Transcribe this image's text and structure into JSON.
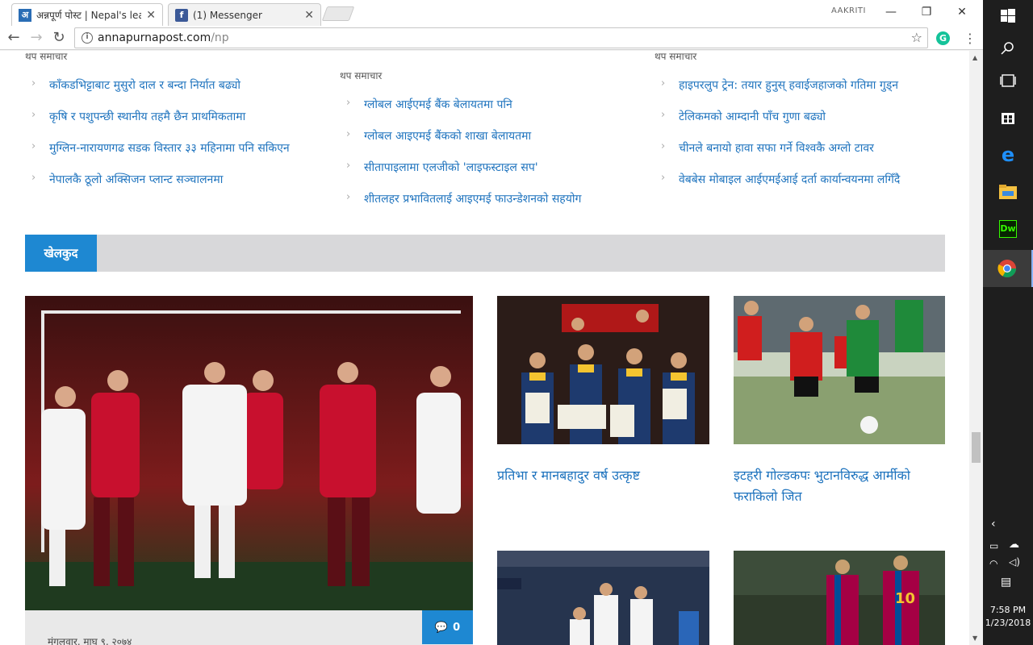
{
  "browser": {
    "tabs": [
      {
        "title": "अन्नपूर्ण पोस्ट | Nepal's lea",
        "favicon": "अ",
        "favicon_color": "#2a6db5"
      },
      {
        "title": "(1) Messenger",
        "favicon": "f",
        "favicon_color": "#3b5998"
      }
    ],
    "user": "AAKRITI",
    "url_domain": "annapurnapost.com",
    "url_path": "/np"
  },
  "news_columns": {
    "label": "थप समाचार",
    "left": [
      "काँकडभिट्टाबाट मुसुरो दाल र बन्दा निर्यात बढ्यो",
      "कृषि र पशुपन्छी  स्थानीय तहमै छैन प्राथमिकतामा",
      "मुग्लिन-नारायणगढ सडक विस्तार ३३ महिनामा पनि सकिएन",
      "नेपालकै ठूलो अक्सिजन प्लान्ट सञ्चालनमा"
    ],
    "middle": [
      "ग्लोबल आईएमई बैंक बेलायतमा पनि",
      "ग्लोबल आइएमई बैंकको शाखा बेलायतमा",
      "सीतापाइलामा एलजीको 'लाइफस्टाइल सप'",
      "शीतलहर प्रभावितलाई आइएमई फाउन्डेशनको सहयोग"
    ],
    "right": [
      "हाइपरलुप ट्रेन: तयार हुनुस् हवाईजहाजको गतिमा गुड्न",
      "टेलिकमको आम्दानी पाँच गुणा बढ्यो",
      "चीनले बनायो हावा सफा गर्ने विश्वकै अग्लो टावर",
      "वेबबेस मोबाइल आईएमईआई दर्ता कार्यान्वयनमा लगिँदै"
    ]
  },
  "sports": {
    "section_title": "खेलकुद",
    "hero_date": "मंगलवार, माघ ९, २०७४",
    "hero_comments": "0",
    "cards": [
      {
        "title": "प्रतिभा र मानबहादुर वर्ष उत्कृष्ट"
      },
      {
        "title": "इटहरी गोल्डकपः भुटानविरुद्ध आर्मीको फराकिलो जित"
      }
    ]
  },
  "taskbar": {
    "time": "7:58 PM",
    "date": "1/23/2018",
    "icons": [
      "windows-icon",
      "search-icon",
      "task-view-icon",
      "store-icon",
      "edge-icon",
      "file-explorer-icon",
      "dreamweaver-icon",
      "chrome-icon"
    ]
  }
}
